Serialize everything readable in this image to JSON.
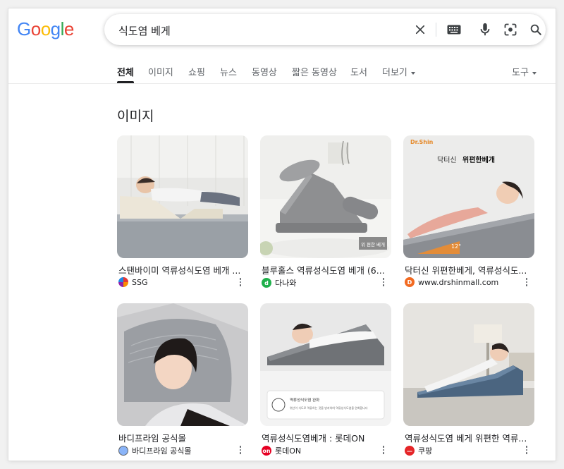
{
  "logo": {
    "letters": [
      "G",
      "o",
      "o",
      "g",
      "l",
      "e"
    ],
    "colors": [
      "#4285F4",
      "#EA4335",
      "#FBBC05",
      "#4285F4",
      "#34A853",
      "#EA4335"
    ]
  },
  "search": {
    "query": "식도염 베게"
  },
  "header_icons": [
    "close-icon",
    "keyboard-icon",
    "microphone-icon",
    "lens-icon",
    "search-icon"
  ],
  "tabs": [
    {
      "label": "전체",
      "active": true
    },
    {
      "label": "이미지"
    },
    {
      "label": "쇼핑"
    },
    {
      "label": "뉴스"
    },
    {
      "label": "동영상"
    },
    {
      "label": "짧은 동영상"
    },
    {
      "label": "도서"
    },
    {
      "label": "더보기"
    }
  ],
  "tools_label": "도구",
  "images_section": {
    "title": "이미지",
    "cards": [
      {
        "title": "스탠바이미 역류성식도염 베개 ...",
        "source": "SSG",
        "favicon": "ssg-favicon",
        "favicon_color": "#ffffff"
      },
      {
        "title": "블루홀스 역류성식도염 베개 (6...",
        "source": "다나와",
        "favicon": "danawa-favicon",
        "favicon_color": "#1fb04b"
      },
      {
        "title": "닥터신 위편한베게, 역류성식도...",
        "source": "www.drshinmall.com",
        "favicon": "drshin-favicon",
        "favicon_color": "#f26a21"
      },
      {
        "title": "바디프라임 공식몰",
        "source": "바디프라임 공식몰",
        "favicon": "globe-favicon",
        "favicon_color": "#8ab4f8"
      },
      {
        "title": "역류성식도염베개 : 롯데ON",
        "source": "롯데ON",
        "favicon": "lotteon-favicon",
        "favicon_color": "#e60023"
      },
      {
        "title": "역류성식도염 베게 위편한 역류...",
        "source": "쿠팡",
        "favicon": "coupang-favicon",
        "favicon_color": "#e52528"
      }
    ]
  },
  "image_overlays": {
    "card2_badge": "위 편한 베개",
    "card3_brand": "Dr.Shin",
    "card3_headline_a": "닥터신",
    "card3_headline_b": "위편한베개",
    "card3_angle": "12°",
    "card5_caption_a": "역류성식도염 완화",
    "card5_caption_b": "위산이 식도로 역류하는 것을 방지하여 역류성식도염을 완화합니다"
  }
}
